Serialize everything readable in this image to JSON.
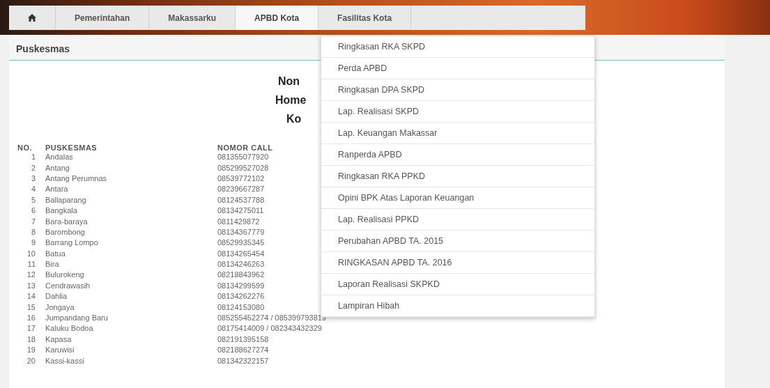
{
  "nav": {
    "tabs": [
      {
        "kind": "home",
        "selected": false
      },
      {
        "kind": "text",
        "label": "Pemerintahan",
        "selected": false
      },
      {
        "kind": "text",
        "label": "Makassarku",
        "selected": false
      },
      {
        "kind": "text",
        "label": "APBD Kota",
        "selected": true
      },
      {
        "kind": "text",
        "label": "Fasilitas Kota",
        "selected": false
      }
    ]
  },
  "dropdown": {
    "items": [
      "Ringkasan RKA SKPD",
      "Perda APBD",
      "Ringkasan DPA SKPD",
      "Lap. Realisasi SKPD",
      "Lap. Keuangan Makassar",
      "Ranperda APBD",
      "Ringkasan RKA PPKD",
      "Opini BPK Atas Laporan Keuangan",
      "Lap. Realisasi PPKD",
      "Perubahan APBD TA. 2015",
      "RINGKASAN APBD TA. 2016",
      "Laporan Realisasi SKPKD",
      "Lampiran Hibah"
    ]
  },
  "panel": {
    "title": "Puskesmas",
    "heading_lines": [
      "Non",
      "Home",
      "Ko"
    ],
    "table": {
      "columns": [
        "NO.",
        "PUSKESMAS",
        "NOMOR CALL"
      ],
      "rows": [
        [
          "1",
          "Andalas",
          "081355077920"
        ],
        [
          "2",
          "Antang",
          "085299527028"
        ],
        [
          "3",
          "Antang Perumnas",
          "08539772102"
        ],
        [
          "4",
          "Antara",
          "08239667287"
        ],
        [
          "5",
          "Ballaparang",
          "08124537788"
        ],
        [
          "6",
          "Bangkala",
          "08134275011"
        ],
        [
          "7",
          "Bara-baraya",
          "0811429872"
        ],
        [
          "8",
          "Barombong",
          "08134367779"
        ],
        [
          "9",
          "Barrang Lompo",
          "08529935345"
        ],
        [
          "10",
          "Batua",
          "08134265454"
        ],
        [
          "11",
          "Bira",
          "08134246263"
        ],
        [
          "12",
          "Bulurokeng",
          "08218843962"
        ],
        [
          "13",
          "Cendrawasih",
          "08134299599"
        ],
        [
          "14",
          "Dahlia",
          "08134262276"
        ],
        [
          "15",
          "Jongaya",
          "08124153080"
        ],
        [
          "16",
          "Jumpandang Baru",
          "085255452274 / 085399793819"
        ],
        [
          "17",
          "Kaluku Bodoa",
          "08175414009 / 082343432329"
        ],
        [
          "18",
          "Kapasa",
          "082191395158"
        ],
        [
          "19",
          "Karuwisi",
          "082188627274"
        ],
        [
          "20",
          "Kassi-kassi",
          "081342322157"
        ]
      ]
    }
  }
}
